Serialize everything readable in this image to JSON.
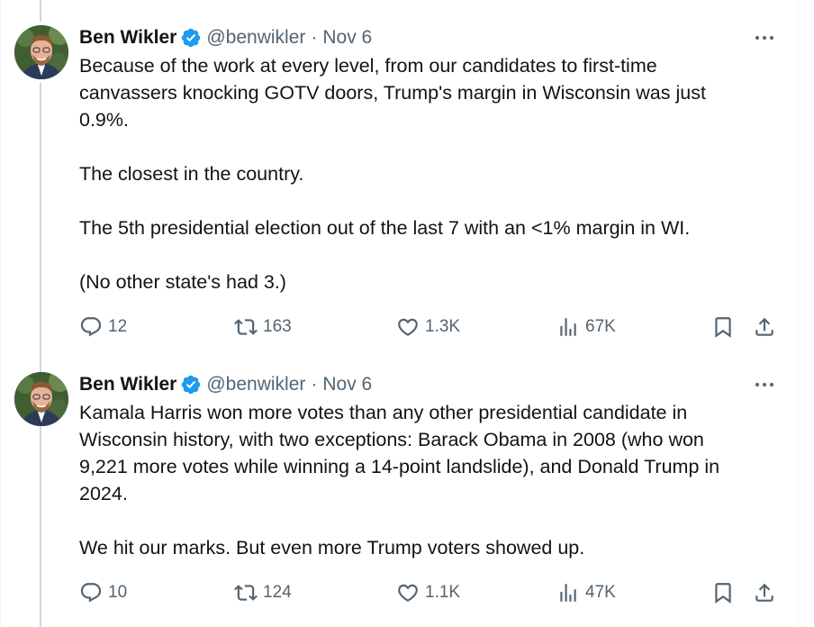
{
  "tweets": [
    {
      "author_name": "Ben Wikler",
      "handle": "@benwikler",
      "separator": "·",
      "date": "Nov 6",
      "body_lines": [
        "Because of the work at every level, from our candidates to first-time",
        "canvassers knocking GOTV doors, Trump's margin in Wisconsin was just",
        "0.9%.",
        "",
        "The closest in the country.",
        "",
        "The 5th presidential election out of the last 7 with an <1% margin in WI.",
        "",
        "(No other state's had 3.)"
      ],
      "replies": "12",
      "reposts": "163",
      "likes": "1.3K",
      "views": "67K"
    },
    {
      "author_name": "Ben Wikler",
      "handle": "@benwikler",
      "separator": "·",
      "date": "Nov 6",
      "body_lines": [
        "Kamala Harris won more votes than any other presidential candidate in",
        "Wisconsin history, with two exceptions: Barack Obama in 2008 (who won",
        "9,221 more votes while winning a 14-point landslide), and Donald Trump in",
        "2024.",
        "",
        "We hit our marks. But even more Trump voters showed up."
      ],
      "replies": "10",
      "reposts": "124",
      "likes": "1.1K",
      "views": "47K"
    }
  ],
  "icons": {
    "verified": "verified-badge-icon",
    "more": "more-options-icon",
    "reply": "reply-icon",
    "repost": "repost-icon",
    "like": "heart-icon",
    "views": "views-icon",
    "bookmark": "bookmark-icon",
    "share": "share-icon"
  },
  "colors": {
    "verified_blue": "#1d9bf0",
    "text_primary": "#0f1419",
    "text_secondary": "#536471",
    "thread_line": "#cfd9de"
  }
}
